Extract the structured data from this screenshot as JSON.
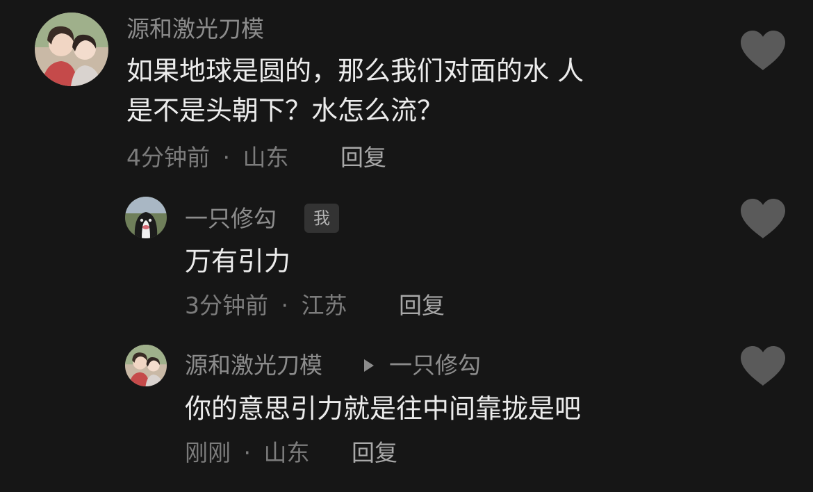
{
  "comments": [
    {
      "username": "源和激光刀模",
      "text_lines": [
        "如果地球是圆的，那么我们对面的水 人",
        "是不是头朝下？水怎么流？"
      ],
      "time": "4分钟前",
      "location": "山东",
      "reply_label": "回复",
      "like_icon": "heart-icon"
    },
    {
      "username": "一只修勾",
      "badge": "我",
      "text_lines": [
        "万有引力"
      ],
      "time": "3分钟前",
      "location": "江苏",
      "reply_label": "回复",
      "like_icon": "heart-icon"
    },
    {
      "username": "源和激光刀模",
      "reply_to": "一只修勾",
      "text_lines": [
        "你的意思引力就是往中间靠拢是吧"
      ],
      "time": "刚刚",
      "location": "山东",
      "reply_label": "回复",
      "like_icon": "heart-icon"
    }
  ],
  "separator": "·",
  "colors": {
    "background": "#161616",
    "text": "#ececec",
    "muted": "#8c8c8c",
    "heart": "#5a5a5a"
  }
}
